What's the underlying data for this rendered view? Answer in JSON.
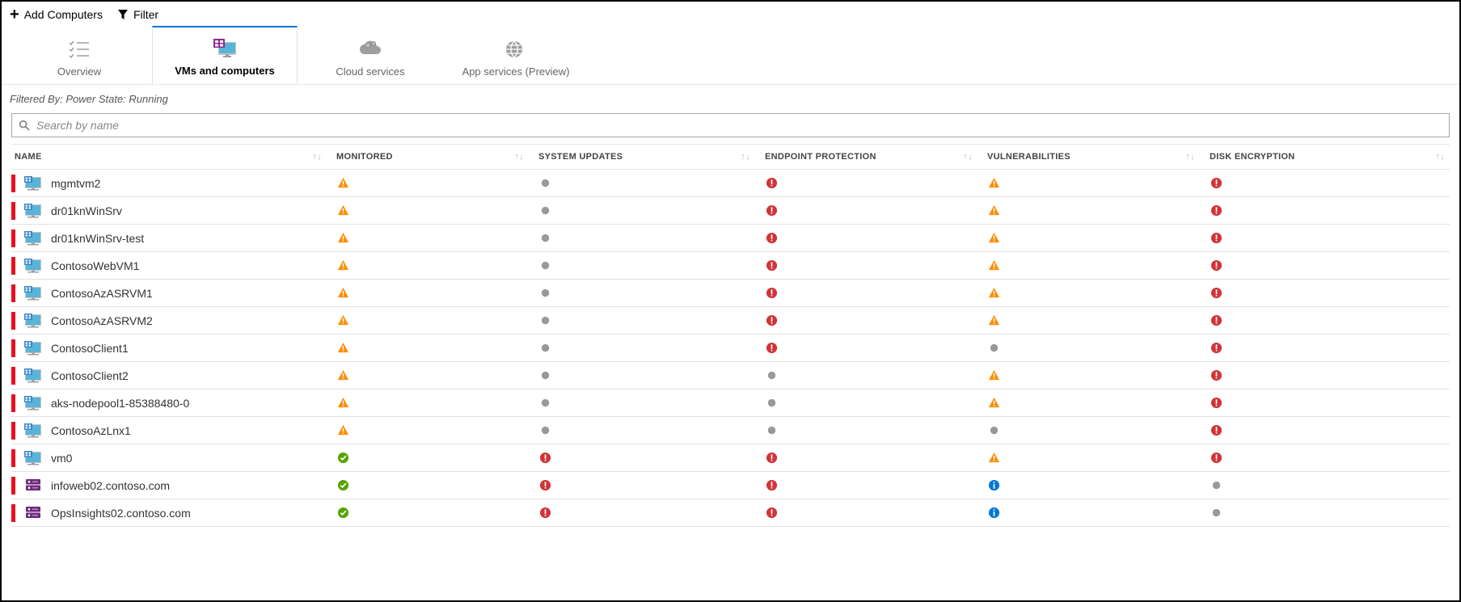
{
  "toolbar": {
    "add_label": "Add Computers",
    "filter_label": "Filter"
  },
  "tabs": [
    {
      "label": "Overview",
      "icon": "list",
      "active": false
    },
    {
      "label": "VMs and computers",
      "icon": "vm",
      "active": true
    },
    {
      "label": "Cloud services",
      "icon": "cloud",
      "active": false
    },
    {
      "label": "App services (Preview)",
      "icon": "globe",
      "active": false
    }
  ],
  "filter_text": "Filtered By: Power State: Running",
  "search": {
    "placeholder": "Search by name"
  },
  "columns": [
    {
      "label": "NAME"
    },
    {
      "label": "MONITORED"
    },
    {
      "label": "SYSTEM UPDATES"
    },
    {
      "label": "ENDPOINT PROTECTION"
    },
    {
      "label": "VULNERABILITIES"
    },
    {
      "label": "DISK ENCRYPTION"
    }
  ],
  "rows": [
    {
      "name": "mgmtvm2",
      "type": "vm",
      "monitored": "warn",
      "updates": "gray",
      "endpoint": "err",
      "vuln": "warn",
      "disk": "err"
    },
    {
      "name": "dr01knWinSrv",
      "type": "vm",
      "monitored": "warn",
      "updates": "gray",
      "endpoint": "err",
      "vuln": "warn",
      "disk": "err"
    },
    {
      "name": "dr01knWinSrv-test",
      "type": "vm",
      "monitored": "warn",
      "updates": "gray",
      "endpoint": "err",
      "vuln": "warn",
      "disk": "err"
    },
    {
      "name": "ContosoWebVM1",
      "type": "vm",
      "monitored": "warn",
      "updates": "gray",
      "endpoint": "err",
      "vuln": "warn",
      "disk": "err"
    },
    {
      "name": "ContosoAzASRVM1",
      "type": "vm",
      "monitored": "warn",
      "updates": "gray",
      "endpoint": "err",
      "vuln": "warn",
      "disk": "err"
    },
    {
      "name": "ContosoAzASRVM2",
      "type": "vm",
      "monitored": "warn",
      "updates": "gray",
      "endpoint": "err",
      "vuln": "warn",
      "disk": "err"
    },
    {
      "name": "ContosoClient1",
      "type": "vm",
      "monitored": "warn",
      "updates": "gray",
      "endpoint": "err",
      "vuln": "gray",
      "disk": "err"
    },
    {
      "name": "ContosoClient2",
      "type": "vm",
      "monitored": "warn",
      "updates": "gray",
      "endpoint": "gray",
      "vuln": "warn",
      "disk": "err"
    },
    {
      "name": "aks-nodepool1-85388480-0",
      "type": "vm",
      "monitored": "warn",
      "updates": "gray",
      "endpoint": "gray",
      "vuln": "warn",
      "disk": "err"
    },
    {
      "name": "ContosoAzLnx1",
      "type": "vm",
      "monitored": "warn",
      "updates": "gray",
      "endpoint": "gray",
      "vuln": "gray",
      "disk": "err"
    },
    {
      "name": "vm0",
      "type": "vm",
      "monitored": "ok",
      "updates": "err",
      "endpoint": "err",
      "vuln": "warn",
      "disk": "err"
    },
    {
      "name": "infoweb02.contoso.com",
      "type": "host",
      "monitored": "ok",
      "updates": "err",
      "endpoint": "err",
      "vuln": "info",
      "disk": "gray"
    },
    {
      "name": "OpsInsights02.contoso.com",
      "type": "host",
      "monitored": "ok",
      "updates": "err",
      "endpoint": "err",
      "vuln": "info",
      "disk": "gray"
    }
  ]
}
